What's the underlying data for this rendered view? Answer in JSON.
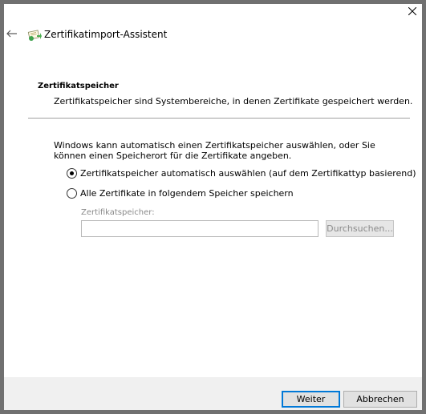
{
  "window": {
    "title": "Zertifikatimport-Assistent"
  },
  "section": {
    "heading": "Zertifikatspeicher",
    "description": "Zertifikatspeicher sind Systembereiche, in denen Zertifikate gespeichert werden."
  },
  "intro": "Windows kann automatisch einen Zertifikatspeicher auswählen, oder Sie können einen Speicherort für die Zertifikate angeben.",
  "options": [
    {
      "label": "Zertifikatspeicher automatisch auswählen (auf dem Zertifikattyp basierend)",
      "selected": true
    },
    {
      "label": "Alle Zertifikate in folgendem Speicher speichern",
      "selected": false
    }
  ],
  "store": {
    "label": "Zertifikatspeicher:",
    "value": "",
    "browse_label": "Durchsuchen..."
  },
  "footer": {
    "next_label": "Weiter",
    "cancel_label": "Abbrechen"
  },
  "icons": {
    "close": "close-icon",
    "back": "back-arrow-icon",
    "app": "certificate-icon"
  },
  "colors": {
    "accent": "#0078d7",
    "footer_bg": "#f0f0f0",
    "frame": "#707070"
  }
}
